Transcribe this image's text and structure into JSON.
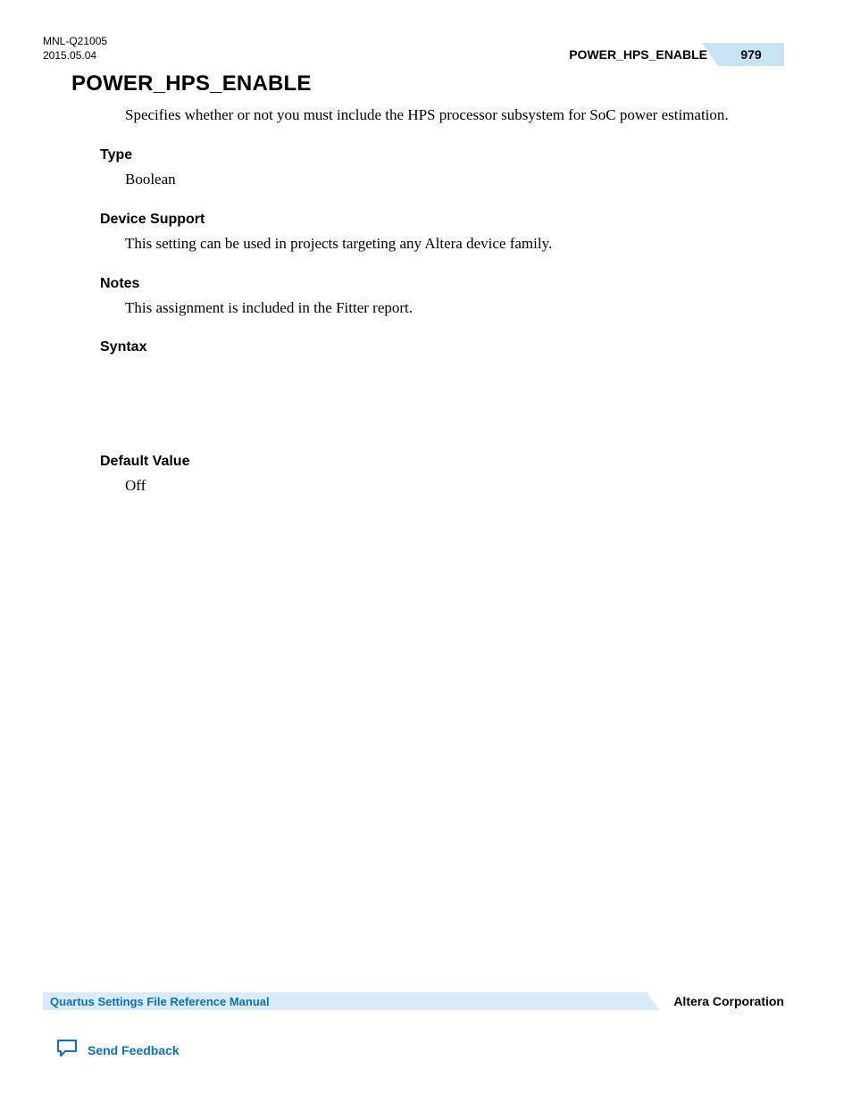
{
  "header": {
    "doc_id": "MNL-Q21005",
    "date": "2015.05.04",
    "setting_name": "POWER_HPS_ENABLE",
    "page_number": "979"
  },
  "main": {
    "title": "POWER_HPS_ENABLE",
    "intro": "Specifies whether or not you must include the HPS processor subsystem for SoC power estimation.",
    "sections": {
      "type": {
        "heading": "Type",
        "body": "Boolean"
      },
      "device_support": {
        "heading": "Device Support",
        "body": "This setting can be used in projects targeting any Altera device family."
      },
      "notes": {
        "heading": "Notes",
        "body": "This assignment is included in the Fitter report."
      },
      "syntax": {
        "heading": "Syntax",
        "body": ""
      },
      "default_value": {
        "heading": "Default Value",
        "body": "Off"
      }
    }
  },
  "footer": {
    "manual_title": "Quartus Settings File Reference Manual",
    "corporation": "Altera Corporation",
    "feedback_label": "Send Feedback"
  }
}
